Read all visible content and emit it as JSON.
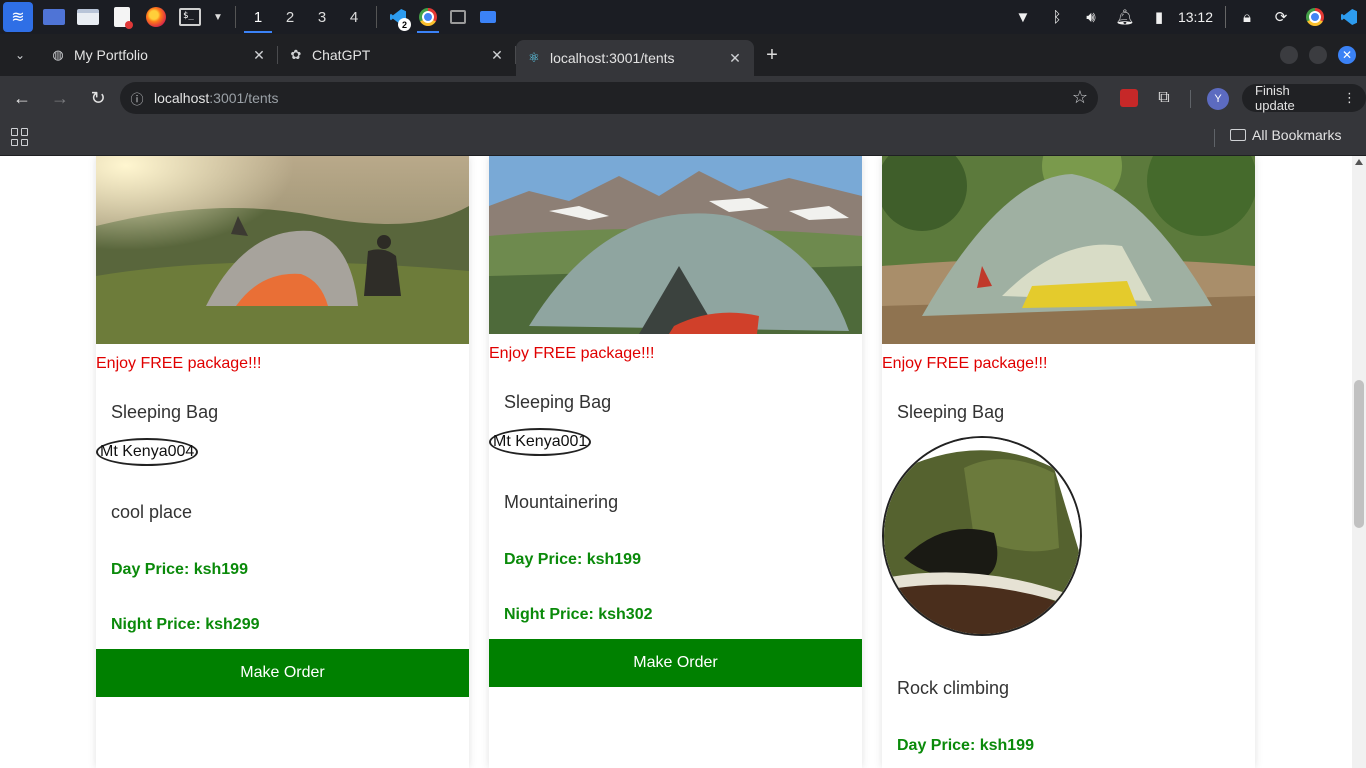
{
  "taskbar": {
    "workspaces": [
      "1",
      "2",
      "3",
      "4"
    ],
    "vscode_badge": "2",
    "clock": "13:12"
  },
  "browser": {
    "tabs": [
      {
        "title": "My Portfolio",
        "icon": "globe-icon"
      },
      {
        "title": "ChatGPT",
        "icon": "openai-icon"
      },
      {
        "title": "localhost:3001/tents",
        "icon": "react-icon"
      }
    ],
    "active_tab": 2,
    "url_host": "localhost",
    "url_path": ":3001/tents",
    "profile_initial": "Y",
    "finish_update_label": "Finish update",
    "all_bookmarks_label": "All Bookmarks"
  },
  "page": {
    "cards": [
      {
        "promo": "Enjoy FREE package!!!",
        "item": "Sleeping Bag",
        "thumb_alt": "Mt Kenya004",
        "description": "cool place",
        "day_price": "Day Price: ksh199",
        "night_price": "Night Price: ksh299",
        "button": "Make Order"
      },
      {
        "promo": "Enjoy FREE package!!!",
        "item": "Sleeping Bag",
        "thumb_alt": "Mt Kenya001",
        "description": "Mountainering",
        "day_price": "Day Price: ksh199",
        "night_price": "Night Price: ksh302",
        "button": "Make Order"
      },
      {
        "promo": "Enjoy FREE package!!!",
        "item": "Sleeping Bag",
        "description": "Rock climbing",
        "day_price": "Day Price: ksh199"
      }
    ]
  },
  "colors": {
    "promo": "#e00000",
    "price": "#0a8a0a",
    "button": "#008000"
  }
}
